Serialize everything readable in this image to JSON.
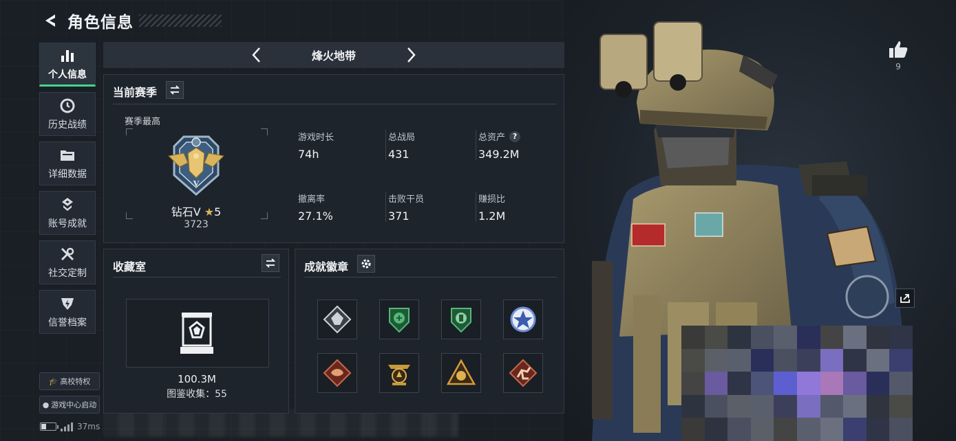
{
  "header": {
    "title": "角色信息"
  },
  "sidebar": {
    "items": [
      {
        "label": "个人信息",
        "icon": "bar-chart-icon",
        "active": true
      },
      {
        "label": "历史战绩",
        "icon": "history-clock-icon",
        "active": false
      },
      {
        "label": "详细数据",
        "icon": "folder-icon",
        "active": false
      },
      {
        "label": "账号成就",
        "icon": "achievement-icon",
        "active": false
      },
      {
        "label": "社交定制",
        "icon": "tools-icon",
        "active": false
      },
      {
        "label": "信誉档案",
        "icon": "shield-bolt-icon",
        "active": false
      }
    ],
    "campus_label": "高校特权",
    "game_center_label": "游戏中心启动"
  },
  "status": {
    "latency": "37ms",
    "battery_level": 0.35
  },
  "season_switcher": {
    "name": "烽火地带"
  },
  "current_season": {
    "title": "当前赛季",
    "rank_caption": "赛季最高",
    "rank_name": "钻石V",
    "rank_stars": "5",
    "rank_points": "3723",
    "stats": [
      {
        "label": "游戏时长",
        "value": "74h"
      },
      {
        "label": "总战局",
        "value": "431"
      },
      {
        "label": "总资产",
        "value": "349.2M",
        "help": "?"
      },
      {
        "label": "撤离率",
        "value": "27.1%"
      },
      {
        "label": "击败干员",
        "value": "371"
      },
      {
        "label": "赚损比",
        "value": "1.2M"
      }
    ]
  },
  "collection": {
    "title": "收藏室",
    "value": "100.3M",
    "count_text": "图鉴收集：55"
  },
  "badges": {
    "title": "成就徽章",
    "items": [
      {
        "icon": "diamond-badge-icon",
        "color": "#cfd3d6"
      },
      {
        "icon": "green-shield-badge-icon",
        "color": "#3f9a5c"
      },
      {
        "icon": "green-shield-badge-icon",
        "color": "#3f9a5c"
      },
      {
        "icon": "blue-star-badge-icon",
        "color": "#6f8fd6"
      },
      {
        "icon": "red-dragon-badge-icon",
        "color": "#b5473a"
      },
      {
        "icon": "gold-tower-badge-icon",
        "color": "#c89a3a"
      },
      {
        "icon": "gold-triangle-badge-icon",
        "color": "#c98a3a"
      },
      {
        "icon": "red-runner-badge-icon",
        "color": "#b5473a"
      }
    ]
  },
  "profile": {
    "likes": "9"
  },
  "colors": {
    "accent": "#44d68f",
    "panel": "#1e242c",
    "gold": "#d9b45a"
  }
}
